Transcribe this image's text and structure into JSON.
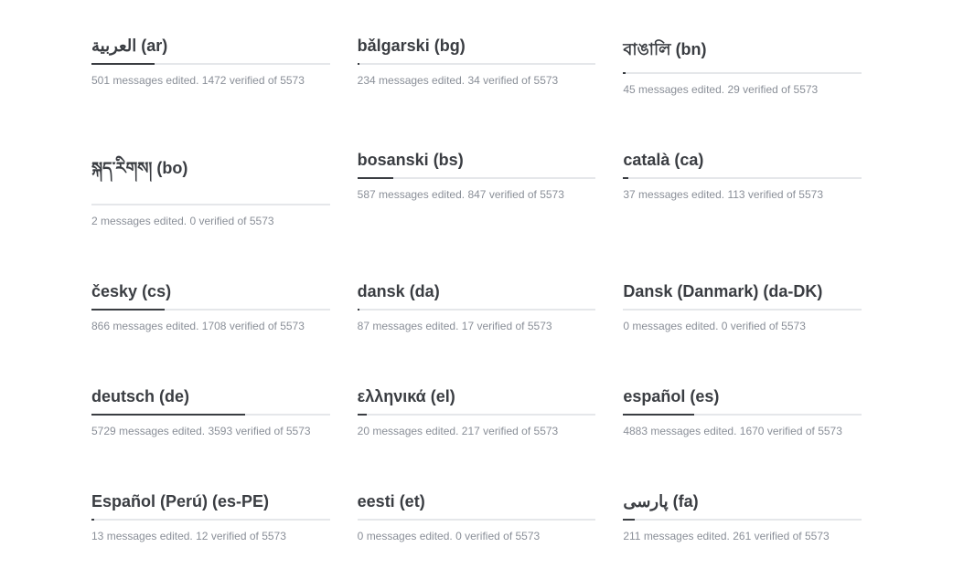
{
  "total": 5573,
  "languages": [
    {
      "native": "العربية",
      "code": "ar",
      "edited": 501,
      "verified": 1472
    },
    {
      "native": "bǎlgarski",
      "code": "bg",
      "edited": 234,
      "verified": 34
    },
    {
      "native": "বাঙালি",
      "code": "bn",
      "edited": 45,
      "verified": 29
    },
    {
      "native": "སྐད་རིགས།",
      "code": "bo",
      "edited": 2,
      "verified": 0
    },
    {
      "native": "bosanski",
      "code": "bs",
      "edited": 587,
      "verified": 847
    },
    {
      "native": "català",
      "code": "ca",
      "edited": 37,
      "verified": 113
    },
    {
      "native": "česky",
      "code": "cs",
      "edited": 866,
      "verified": 1708
    },
    {
      "native": "dansk",
      "code": "da",
      "edited": 87,
      "verified": 17
    },
    {
      "native": "Dansk (Danmark)",
      "code": "da-DK",
      "edited": 0,
      "verified": 0
    },
    {
      "native": "deutsch",
      "code": "de",
      "edited": 5729,
      "verified": 3593
    },
    {
      "native": "ελληνικά",
      "code": "el",
      "edited": 20,
      "verified": 217
    },
    {
      "native": "español",
      "code": "es",
      "edited": 4883,
      "verified": 1670
    },
    {
      "native": "Español (Perú)",
      "code": "es-PE",
      "edited": 13,
      "verified": 12
    },
    {
      "native": "eesti",
      "code": "et",
      "edited": 0,
      "verified": 0
    },
    {
      "native": "پارسی",
      "code": "fa",
      "edited": 211,
      "verified": 261
    }
  ],
  "labels": {
    "msg_edited": "messages edited.",
    "verified_of": "verified of"
  }
}
